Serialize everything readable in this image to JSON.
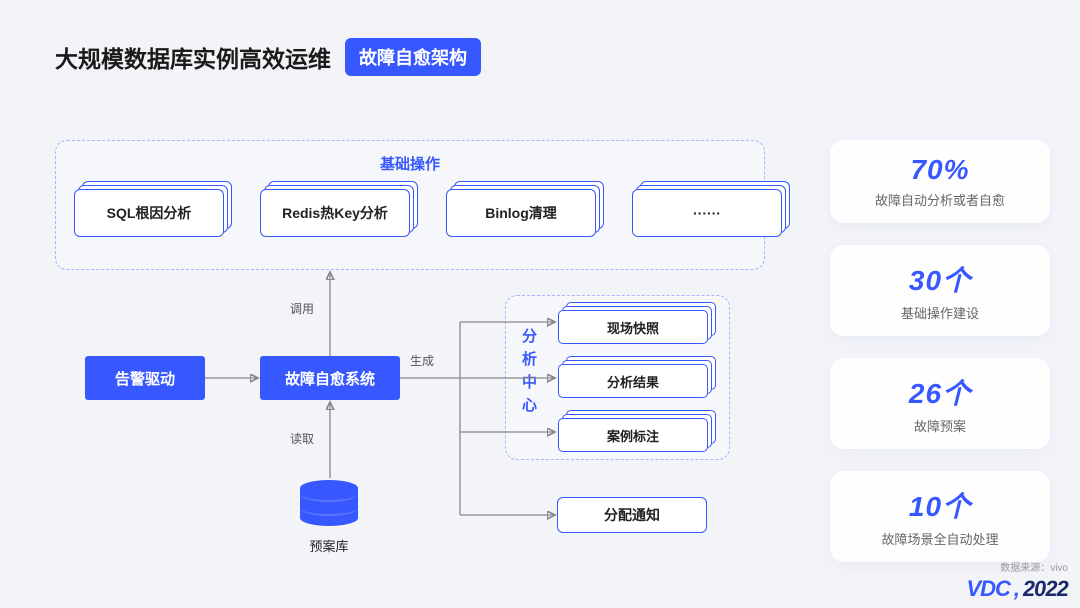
{
  "title": {
    "main": "大规模数据库实例高效运维",
    "badge": "故障自愈架构"
  },
  "basic_ops": {
    "title": "基础操作",
    "items": [
      "SQL根因分析",
      "Redis热Key分析",
      "Binlog清理",
      "······"
    ]
  },
  "flow": {
    "alert_driven": "告警驱动",
    "self_heal_system": "故障自愈系统",
    "edges": {
      "call": "调用",
      "generate": "生成",
      "read": "读取"
    },
    "preplan_db": "预案库"
  },
  "analysis_center": {
    "title": "分析中心",
    "items": [
      "现场快照",
      "分析结果",
      "案例标注"
    ]
  },
  "dispatch_notice": "分配通知",
  "stats": [
    {
      "value": "70%",
      "label": "故障自动分析或者自愈"
    },
    {
      "value": "30个",
      "label": "基础操作建设"
    },
    {
      "value": "26个",
      "label": "故障预案"
    },
    {
      "value": "10个",
      "label": "故障场景全自动处理"
    }
  ],
  "footer": {
    "source": "数据来源：vivo",
    "logo_text": "VDC",
    "year": "2022"
  }
}
